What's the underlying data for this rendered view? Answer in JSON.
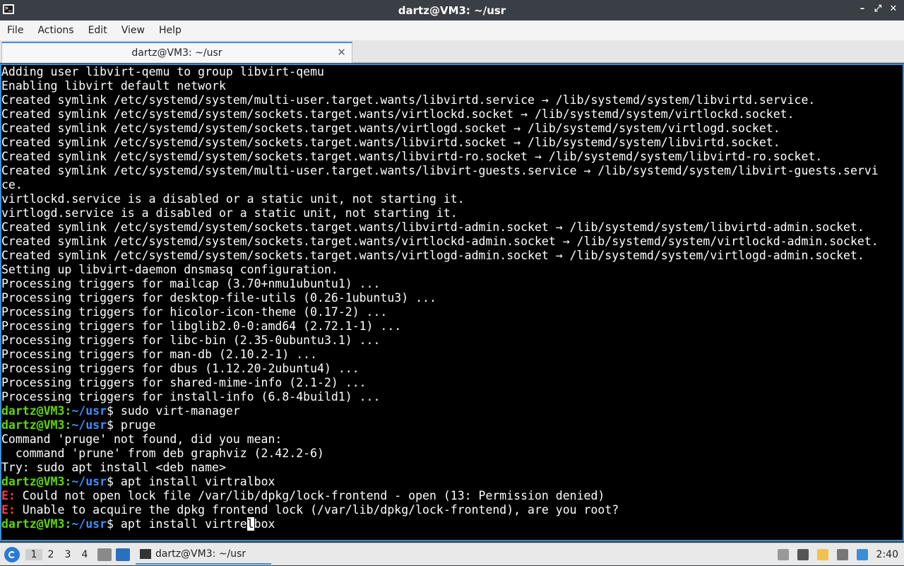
{
  "window": {
    "title": "dartz@VM3: ~/usr",
    "controls": [
      "–",
      "⤢",
      "✕"
    ]
  },
  "menu": [
    "File",
    "Actions",
    "Edit",
    "View",
    "Help"
  ],
  "tab": {
    "label": "dartz@VM3: ~/usr",
    "close": "✕"
  },
  "terminal": {
    "lines": [
      {
        "t": "out",
        "text": "Adding user libvirt-qemu to group libvirt-qemu"
      },
      {
        "t": "out",
        "text": "Enabling libvirt default network"
      },
      {
        "t": "out",
        "text": "Created symlink /etc/systemd/system/multi-user.target.wants/libvirtd.service → /lib/systemd/system/libvirtd.service."
      },
      {
        "t": "out",
        "text": "Created symlink /etc/systemd/system/sockets.target.wants/virtlockd.socket → /lib/systemd/system/virtlockd.socket."
      },
      {
        "t": "out",
        "text": "Created symlink /etc/systemd/system/sockets.target.wants/virtlogd.socket → /lib/systemd/system/virtlogd.socket."
      },
      {
        "t": "out",
        "text": "Created symlink /etc/systemd/system/sockets.target.wants/libvirtd.socket → /lib/systemd/system/libvirtd.socket."
      },
      {
        "t": "out",
        "text": "Created symlink /etc/systemd/system/sockets.target.wants/libvirtd-ro.socket → /lib/systemd/system/libvirtd-ro.socket."
      },
      {
        "t": "out",
        "text": "Created symlink /etc/systemd/system/multi-user.target.wants/libvirt-guests.service → /lib/systemd/system/libvirt-guests.servi"
      },
      {
        "t": "out",
        "text": "ce."
      },
      {
        "t": "out",
        "text": "virtlockd.service is a disabled or a static unit, not starting it."
      },
      {
        "t": "out",
        "text": "virtlogd.service is a disabled or a static unit, not starting it."
      },
      {
        "t": "out",
        "text": "Created symlink /etc/systemd/system/sockets.target.wants/libvirtd-admin.socket → /lib/systemd/system/libvirtd-admin.socket."
      },
      {
        "t": "out",
        "text": "Created symlink /etc/systemd/system/sockets.target.wants/virtlockd-admin.socket → /lib/systemd/system/virtlockd-admin.socket."
      },
      {
        "t": "out",
        "text": "Created symlink /etc/systemd/system/sockets.target.wants/virtlogd-admin.socket → /lib/systemd/system/virtlogd-admin.socket."
      },
      {
        "t": "out",
        "text": "Setting up libvirt-daemon dnsmasq configuration."
      },
      {
        "t": "out",
        "text": "Processing triggers for mailcap (3.70+nmu1ubuntu1) ..."
      },
      {
        "t": "out",
        "text": "Processing triggers for desktop-file-utils (0.26-1ubuntu3) ..."
      },
      {
        "t": "out",
        "text": "Processing triggers for hicolor-icon-theme (0.17-2) ..."
      },
      {
        "t": "out",
        "text": "Processing triggers for libglib2.0-0:amd64 (2.72.1-1) ..."
      },
      {
        "t": "out",
        "text": "Processing triggers for libc-bin (2.35-0ubuntu3.1) ..."
      },
      {
        "t": "out",
        "text": "Processing triggers for man-db (2.10.2-1) ..."
      },
      {
        "t": "out",
        "text": "Processing triggers for dbus (1.12.20-2ubuntu4) ..."
      },
      {
        "t": "out",
        "text": "Processing triggers for shared-mime-info (2.1-2) ..."
      },
      {
        "t": "out",
        "text": "Processing triggers for install-info (6.8-4build1) ..."
      },
      {
        "t": "prompt",
        "user": "dartz@VM3",
        "path": "~/usr",
        "cmd": " sudo virt-manager"
      },
      {
        "t": "prompt",
        "user": "dartz@VM3",
        "path": "~/usr",
        "cmd": " pruge"
      },
      {
        "t": "out",
        "text": "Command 'pruge' not found, did you mean:"
      },
      {
        "t": "out",
        "text": "  command 'prune' from deb graphviz (2.42.2-6)"
      },
      {
        "t": "out",
        "text": "Try: sudo apt install <deb name>"
      },
      {
        "t": "prompt",
        "user": "dartz@VM3",
        "path": "~/usr",
        "cmd": " apt install virtralbox"
      },
      {
        "t": "err",
        "prefix": "E:",
        "text": " Could not open lock file /var/lib/dpkg/lock-frontend - open (13: Permission denied)"
      },
      {
        "t": "err",
        "prefix": "E:",
        "text": " Unable to acquire the dpkg frontend lock (/var/lib/dpkg/lock-frontend), are you root?"
      },
      {
        "t": "prompt",
        "user": "dartz@VM3",
        "path": "~/usr",
        "cmd": " apt install virtre",
        "cursor": "l",
        "after": "box"
      }
    ]
  },
  "taskbar": {
    "workspaces": [
      "1",
      "2",
      "3",
      "4"
    ],
    "active_workspace": "1",
    "task_label": "dartz@VM3: ~/usr",
    "clock": "2:40",
    "colors": {
      "accent": "#3b8ed6",
      "prompt_user": "#5fd700",
      "prompt_path": "#3e8fff",
      "error": "#ff3b3b"
    }
  }
}
